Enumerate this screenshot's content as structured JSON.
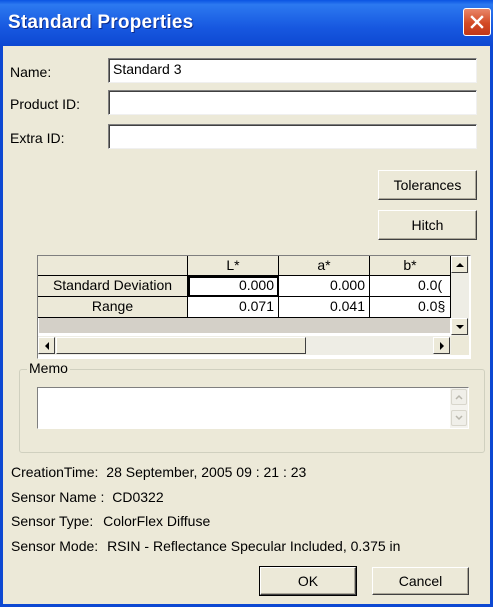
{
  "window": {
    "title": "Standard Properties"
  },
  "fields": {
    "name_label": "Name:",
    "name_value": "Standard 3",
    "product_id_label": "Product ID:",
    "product_id_value": "",
    "extra_id_label": "Extra ID:",
    "extra_id_value": ""
  },
  "buttons": {
    "tolerances": "Tolerances",
    "hitch": "Hitch",
    "ok": "OK",
    "cancel": "Cancel"
  },
  "grid": {
    "columns": [
      "L*",
      "a*",
      "b*"
    ],
    "rows": [
      {
        "label": "Standard Deviation",
        "values": [
          "0.000",
          "0.000",
          "0.0("
        ]
      },
      {
        "label": "Range",
        "values": [
          "0.071",
          "0.041",
          "0.0§"
        ]
      }
    ]
  },
  "memo": {
    "label": "Memo",
    "value": ""
  },
  "info": {
    "creation_time_label": "CreationTime:",
    "creation_time_value": "28 September, 2005 09 : 21 : 23",
    "sensor_name_label": "Sensor Name :",
    "sensor_name_value": "CD0322",
    "sensor_type_label": "Sensor Type:",
    "sensor_type_value": "ColorFlex Diffuse",
    "sensor_mode_label": "Sensor Mode:",
    "sensor_mode_value": "RSIN - Reflectance Specular Included, 0.375 in"
  },
  "icons": {
    "close": "close-icon",
    "scroll_up": "arrow-up-icon",
    "scroll_down": "arrow-down-icon",
    "scroll_left": "arrow-left-icon",
    "scroll_right": "arrow-right-icon"
  },
  "colors": {
    "titlebar": "#0d48d2",
    "close_button": "#d34a25",
    "dialog_background": "#ece9d8"
  }
}
